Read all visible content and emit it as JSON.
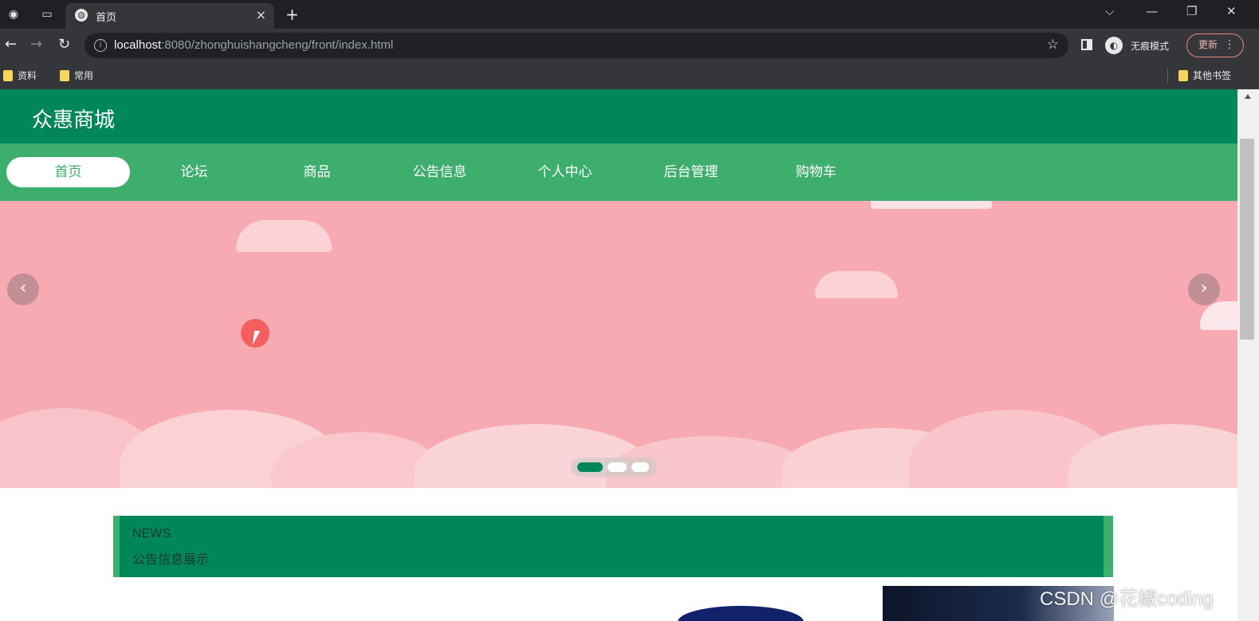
{
  "browser": {
    "tab_title": "首页",
    "tab_close": "×",
    "new_tab": "+",
    "url_host": "localhost",
    "url_rest": ":8080/zhonghuishangcheng/front/index.html",
    "incognito_label": "无痕模式",
    "update_label": "更新",
    "bookmarks": [
      "资料",
      "常用"
    ],
    "other_bookmarks": "其他书签"
  },
  "site": {
    "title": "众惠商城",
    "nav": [
      "首页",
      "论坛",
      "商品",
      "公告信息",
      "个人中心",
      "后台管理",
      "购物车"
    ],
    "active_nav_index": 0
  },
  "carousel": {
    "slide_count": 3,
    "active_index": 0,
    "prev_glyph": "‹",
    "next_glyph": "›"
  },
  "news": {
    "title_en": "NEWS",
    "title_cn": "公告信息展示"
  },
  "watermark": "CSDN @花椒coding",
  "colors": {
    "header": "#008759",
    "nav": "#3dae6e",
    "banner": "#f8aab3"
  }
}
